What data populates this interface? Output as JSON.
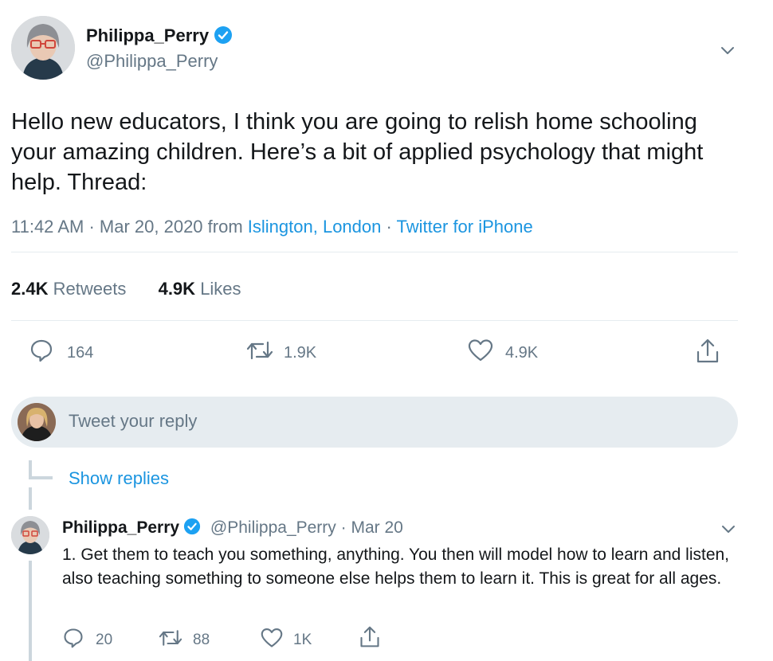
{
  "tweet": {
    "author_name": "Philippa_Perry",
    "author_handle": "@Philippa_Perry",
    "text": "Hello new educators, I think you are going to relish home schooling your amazing children. Here’s a bit of applied psychology that might help. Thread:",
    "time": "11:42 AM",
    "date": "Mar 20, 2020",
    "from_label": "from",
    "location": "Islington, London",
    "source": "Twitter for iPhone",
    "retweets_count": "2.4K",
    "retweets_label": "Retweets",
    "likes_count": "4.9K",
    "likes_label": "Likes",
    "actions": {
      "reply_count": "164",
      "retweet_count": "1.9K",
      "like_count": "4.9K"
    }
  },
  "reply_box": {
    "placeholder": "Tweet your reply"
  },
  "thread": {
    "show_replies": "Show replies"
  },
  "reply_tweet": {
    "author_name": "Philippa_Perry",
    "author_handle": "@Philippa_Perry",
    "date": "Mar 20",
    "text": "1. Get them to teach you something, anything. You then will model how to learn and listen, also teaching something to someone else helps them to learn it. This is great for all ages.",
    "actions": {
      "reply_count": "20",
      "retweet_count": "88",
      "like_count": "1K"
    }
  },
  "colors": {
    "link": "#1b95e0",
    "secondary": "#657786",
    "text": "#14171a",
    "verified": "#1da1f2"
  }
}
